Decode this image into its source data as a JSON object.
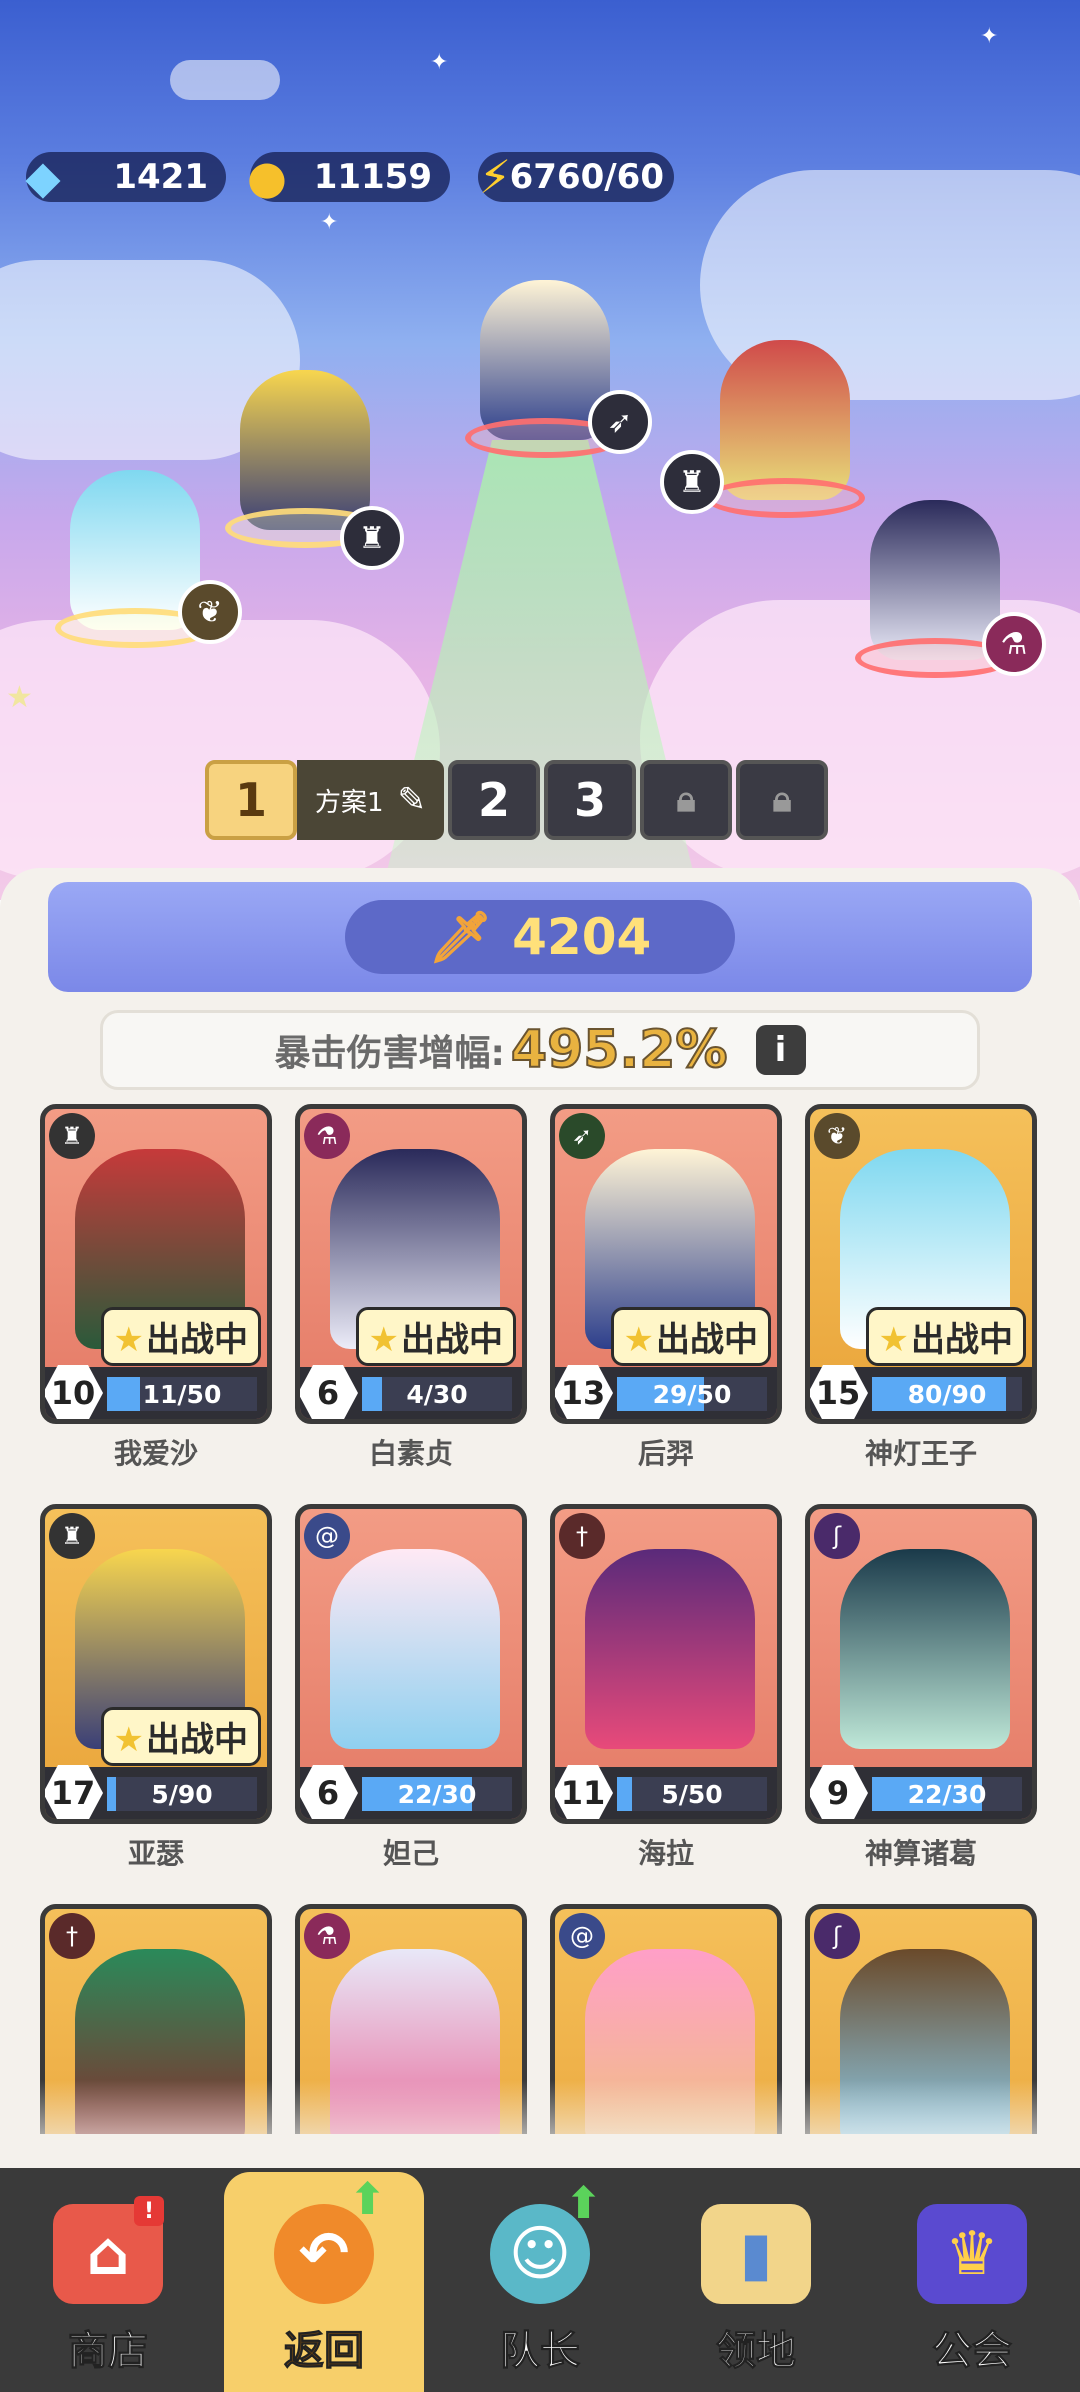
{
  "resources": {
    "diamonds": "1421",
    "coins": "11159",
    "energy": "6760/60"
  },
  "plans": {
    "selected": "1",
    "selected_name": "方案1",
    "others": [
      "2",
      "3"
    ]
  },
  "power": "4204",
  "crit": {
    "label": "暴击伤害增幅:",
    "value": "495.2%"
  },
  "deploy_label": "出战中",
  "heroes": [
    {
      "name": "我爱沙",
      "level": "10",
      "progress": "11/50",
      "fill": 0.22,
      "deployed": true
    },
    {
      "name": "白素贞",
      "level": "6",
      "progress": "4/30",
      "fill": 0.13,
      "deployed": true
    },
    {
      "name": "后羿",
      "level": "13",
      "progress": "29/50",
      "fill": 0.58,
      "deployed": true
    },
    {
      "name": "神灯王子",
      "level": "15",
      "progress": "80/90",
      "fill": 0.89,
      "deployed": true
    },
    {
      "name": "亚瑟",
      "level": "17",
      "progress": "5/90",
      "fill": 0.06,
      "deployed": true
    },
    {
      "name": "妲己",
      "level": "6",
      "progress": "22/30",
      "fill": 0.73,
      "deployed": false
    },
    {
      "name": "海拉",
      "level": "11",
      "progress": "5/50",
      "fill": 0.1,
      "deployed": false
    },
    {
      "name": "神算诸葛",
      "level": "9",
      "progress": "22/30",
      "fill": 0.73,
      "deployed": false
    }
  ],
  "tabs": [
    {
      "label": "商店",
      "icon": "shop-icon"
    },
    {
      "label": "返回",
      "icon": "return-icon"
    },
    {
      "label": "队长",
      "icon": "captain-icon"
    },
    {
      "label": "领地",
      "icon": "territory-icon"
    },
    {
      "label": "公会",
      "icon": "guild-icon"
    }
  ],
  "colors": {
    "accent_gold": "#f7cf6a",
    "power_text": "#ffe07a",
    "crit_value": "#e9b340",
    "progress_fill": "#5aa9f5"
  }
}
